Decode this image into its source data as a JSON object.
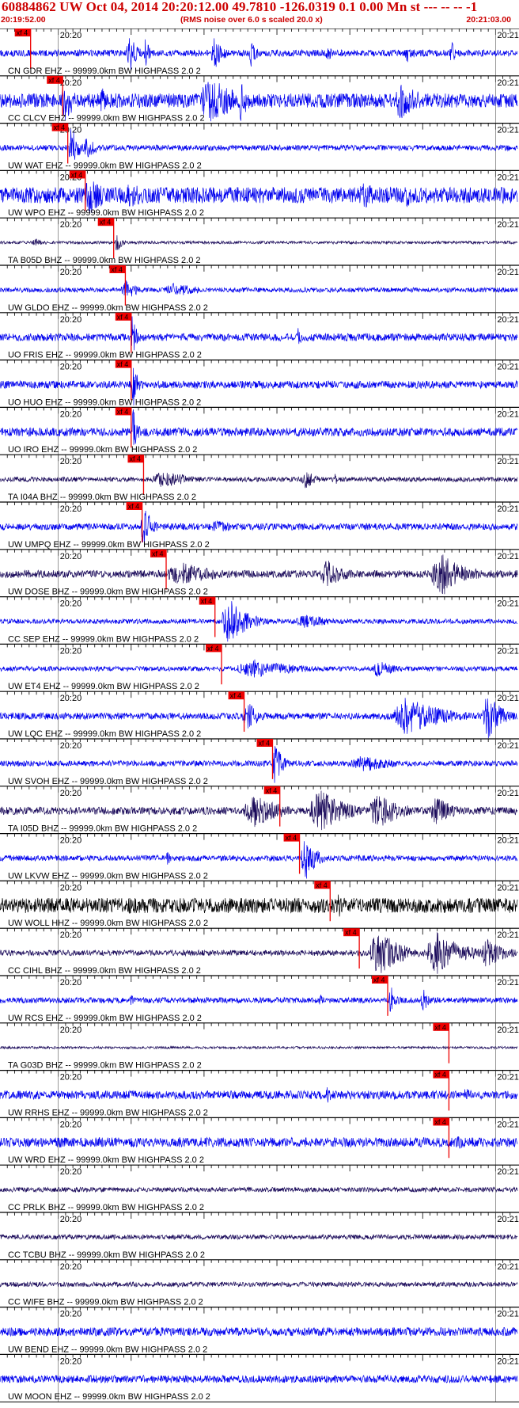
{
  "header": {
    "title": "60884862 UW Oct 04, 2014 20:20:12.00   49.7810 -126.0319  0.1 0.00 Mn st --- -- --   -1",
    "start_time": "20:19:52.00",
    "noise_note": "(RMS noise over 6.0 s scaled 20.0 x)",
    "end_time": "20:21:03.00"
  },
  "chart_data": {
    "type": "line",
    "title": "60884862 UW Oct 04, 2014 20:20:12.00   49.7810 -126.0319  0.1 0.00 Mn st --- -- --   -1",
    "x_axis": {
      "start": "20:19:52.00",
      "end": "20:21:03.00",
      "duration_s": 71,
      "tick_labels": [
        "20:20",
        "20:21"
      ],
      "tick_times_s": [
        8,
        68
      ],
      "minor_tick_interval_s": 1
    },
    "grid": true,
    "pick_label": "xf 4",
    "colors": {
      "trace_blue": "#0000ee",
      "trace_dark": "#1a0a5a",
      "trace_black": "#000000",
      "pick": "#ee0000",
      "header": "#cc0000",
      "text": "#000000"
    },
    "traces": [
      {
        "label": "CN GDR EHZ -- 99999.0km BW  HIGHPASS  2.0  2",
        "color": "blue",
        "pick_s": 4.2,
        "noise": 0.14,
        "seed": 11,
        "bursts": [
          [
            17.8,
            1.6,
            0.9
          ],
          [
            20.0,
            1.0,
            0.7
          ],
          [
            29.5,
            2.0,
            0.7
          ],
          [
            34.5,
            1.2,
            0.6
          ],
          [
            45.0,
            1.0,
            0.5
          ],
          [
            56.0,
            1.4,
            0.5
          ],
          [
            62.0,
            1.0,
            0.5
          ]
        ]
      },
      {
        "label": "CC CLCV EHZ -- 99999.0km BW  HIGHPASS  2.0  2",
        "color": "blue",
        "pick_s": 8.6,
        "noise": 0.3,
        "seed": 23,
        "bursts": [
          [
            9.0,
            2.0,
            1.0
          ],
          [
            14.0,
            1.4,
            0.6
          ],
          [
            29.0,
            6.0,
            1.0
          ],
          [
            33.0,
            2.0,
            0.9
          ],
          [
            55.0,
            5.0,
            0.8
          ]
        ]
      },
      {
        "label": "UW WAT EHZ -- 99999.0km BW  HIGHPASS  2.0  2",
        "color": "blue",
        "pick_s": 9.3,
        "noise": 0.12,
        "seed": 37,
        "bursts": [
          [
            9.8,
            1.5,
            1.0
          ],
          [
            12.0,
            2.0,
            0.5
          ]
        ]
      },
      {
        "label": "UW WPO EHZ -- 99999.0km BW  HIGHPASS  2.0  2",
        "color": "blue",
        "pick_s": 11.7,
        "noise": 0.34,
        "seed": 41,
        "bursts": [
          [
            12.5,
            4.0,
            0.8
          ],
          [
            18.0,
            6.0,
            0.5
          ],
          [
            50.0,
            4.0,
            0.6
          ],
          [
            56.0,
            2.0,
            0.5
          ]
        ]
      },
      {
        "label": "TA B05D BHZ -- 99999.0km BW  HIGHPASS  2.0  2",
        "color": "dark",
        "pick_s": 15.6,
        "noise": 0.06,
        "seed": 53,
        "bursts": [
          [
            16.0,
            1.0,
            0.5
          ],
          [
            5.0,
            3.0,
            0.15
          ]
        ]
      },
      {
        "label": "UW GLDO EHZ -- 99999.0km BW  HIGHPASS  2.0  2",
        "color": "blue",
        "pick_s": 17.2,
        "noise": 0.1,
        "seed": 61,
        "bursts": [
          [
            17.4,
            3.0,
            0.4
          ],
          [
            24.0,
            6.0,
            0.3
          ]
        ]
      },
      {
        "label": "UO FRIS EHZ -- 99999.0km BW  HIGHPASS  2.0  2",
        "color": "blue",
        "pick_s": 18.0,
        "noise": 0.16,
        "seed": 71,
        "bursts": [
          [
            18.2,
            0.9,
            1.0
          ],
          [
            41.0,
            0.8,
            0.5
          ]
        ]
      },
      {
        "label": "UO HUO EHZ -- 99999.0km BW  HIGHPASS  2.0  2",
        "color": "blue",
        "pick_s": 18.0,
        "noise": 0.16,
        "seed": 79,
        "bursts": [
          [
            18.3,
            1.0,
            1.0
          ]
        ]
      },
      {
        "label": "UO IRO EHZ -- 99999.0km BW  HIGHPASS  2.0  2",
        "color": "blue",
        "pick_s": 18.0,
        "noise": 0.18,
        "seed": 83,
        "bursts": [
          [
            18.3,
            1.0,
            1.0
          ]
        ]
      },
      {
        "label": "TA I04A BHZ -- 99999.0km BW  HIGHPASS  2.0  2",
        "color": "dark",
        "pick_s": 19.7,
        "noise": 0.1,
        "seed": 97,
        "bursts": [
          [
            22.5,
            7.0,
            0.35
          ],
          [
            42.0,
            2.5,
            0.4
          ],
          [
            46.0,
            1.0,
            0.25
          ]
        ]
      },
      {
        "label": "UW UMPQ EHZ -- 99999.0km BW  HIGHPASS  2.0  2",
        "color": "blue",
        "pick_s": 19.5,
        "noise": 0.14,
        "seed": 101,
        "bursts": [
          [
            19.8,
            1.8,
            0.9
          ],
          [
            30.0,
            6.0,
            0.25
          ]
        ]
      },
      {
        "label": "UW DOSE BHZ -- 99999.0km BW  HIGHPASS  2.0  2",
        "color": "dark",
        "pick_s": 22.8,
        "noise": 0.16,
        "seed": 107,
        "bursts": [
          [
            25.0,
            8.0,
            0.5
          ],
          [
            45.0,
            4.0,
            0.6
          ],
          [
            60.5,
            5.0,
            1.0
          ]
        ]
      },
      {
        "label": "CC SEP EHZ -- 99999.0km BW  HIGHPASS  2.0  2",
        "color": "blue",
        "pick_s": 29.5,
        "noise": 0.1,
        "seed": 113,
        "bursts": [
          [
            31.5,
            4.0,
            1.0
          ],
          [
            42.0,
            6.0,
            0.3
          ]
        ]
      },
      {
        "label": "UW ET4 EHZ -- 99999.0km BW  HIGHPASS  2.0  2",
        "color": "blue",
        "pick_s": 30.4,
        "noise": 0.1,
        "seed": 127,
        "bursts": [
          [
            35.0,
            10.0,
            0.4
          ],
          [
            52.0,
            4.0,
            0.35
          ]
        ]
      },
      {
        "label": "UW LQC EHZ -- 99999.0km BW  HIGHPASS  2.0  2",
        "color": "blue",
        "pick_s": 33.5,
        "noise": 0.14,
        "seed": 131,
        "bursts": [
          [
            34.0,
            3.0,
            0.6
          ],
          [
            56.0,
            8.0,
            0.8
          ],
          [
            67.0,
            3.0,
            1.0
          ]
        ]
      },
      {
        "label": "UW SVOH EHZ -- 99999.0km BW  HIGHPASS  2.0  2",
        "color": "blue",
        "pick_s": 37.4,
        "noise": 0.12,
        "seed": 137,
        "bursts": [
          [
            37.8,
            1.6,
            0.9
          ],
          [
            50.0,
            8.0,
            0.35
          ]
        ]
      },
      {
        "label": "TA I05D BHZ -- 99999.0km BW  HIGHPASS  2.0  2",
        "color": "dark",
        "pick_s": 38.4,
        "noise": 0.16,
        "seed": 139,
        "bursts": [
          [
            35.0,
            6.0,
            0.7
          ],
          [
            44.0,
            6.0,
            0.9
          ],
          [
            52.0,
            5.0,
            0.8
          ],
          [
            60.0,
            4.0,
            0.6
          ]
        ]
      },
      {
        "label": "UW LKVW EHZ -- 99999.0km BW  HIGHPASS  2.0  2",
        "color": "blue",
        "pick_s": 41.1,
        "noise": 0.12,
        "seed": 149,
        "bursts": [
          [
            42.0,
            2.5,
            0.9
          ],
          [
            23.0,
            1.0,
            0.3
          ]
        ]
      },
      {
        "label": "UW WOLL HHZ -- 99999.0km BW  HIGHPASS  2.0  2",
        "color": "black",
        "pick_s": 45.3,
        "noise": 0.32,
        "seed": 151,
        "bursts": [
          [
            46.5,
            1.5,
            0.6
          ]
        ]
      },
      {
        "label": "CC CIHL BHZ -- 99999.0km BW  HIGHPASS  2.0  2",
        "color": "dark",
        "pick_s": 49.3,
        "noise": 0.12,
        "seed": 157,
        "bursts": [
          [
            52.0,
            5.0,
            1.0
          ],
          [
            60.0,
            6.0,
            0.9
          ],
          [
            67.0,
            4.0,
            0.7
          ]
        ]
      },
      {
        "label": "UW RCS EHZ -- 99999.0km BW  HIGHPASS  2.0  2",
        "color": "blue",
        "pick_s": 53.2,
        "noise": 0.12,
        "seed": 163,
        "bursts": [
          [
            53.6,
            1.2,
            0.8
          ],
          [
            58.0,
            1.0,
            0.8
          ],
          [
            44.0,
            1.0,
            0.3
          ],
          [
            18.0,
            1.0,
            0.25
          ]
        ]
      },
      {
        "label": "TA G03D BHZ -- 99999.0km BW  HIGHPASS  2.0  2",
        "color": "dark",
        "pick_s": 61.6,
        "noise": 0.05,
        "seed": 167,
        "bursts": []
      },
      {
        "label": "UW RRHS EHZ -- 99999.0km BW  HIGHPASS  2.0  2",
        "color": "blue",
        "pick_s": 61.6,
        "noise": 0.18,
        "seed": 173,
        "bursts": [
          [
            45.0,
            1.2,
            0.4
          ],
          [
            64.0,
            2.0,
            0.3
          ]
        ]
      },
      {
        "label": "UW WRD EHZ -- 99999.0km BW  HIGHPASS  2.0  2",
        "color": "blue",
        "pick_s": 61.6,
        "noise": 0.2,
        "seed": 179,
        "bursts": [
          [
            63.0,
            3.0,
            0.3
          ]
        ]
      },
      {
        "label": "CC PRLK BHZ -- 99999.0km BW  HIGHPASS  2.0  2",
        "color": "dark",
        "pick_s": null,
        "noise": 0.1,
        "seed": 181,
        "bursts": []
      },
      {
        "label": "CC TCBU BHZ -- 99999.0km BW  HIGHPASS  2.0  2",
        "color": "dark",
        "pick_s": null,
        "noise": 0.1,
        "seed": 191,
        "bursts": []
      },
      {
        "label": "CC WIFE BHZ -- 99999.0km BW  HIGHPASS  2.0  2",
        "color": "dark",
        "pick_s": null,
        "noise": 0.1,
        "seed": 193,
        "bursts": []
      },
      {
        "label": "UW BEND EHZ -- 99999.0km BW  HIGHPASS  2.0  2",
        "color": "blue",
        "pick_s": null,
        "noise": 0.18,
        "seed": 197,
        "bursts": []
      },
      {
        "label": "UW MOON EHZ -- 99999.0km BW  HIGHPASS  2.0  2",
        "color": "blue",
        "pick_s": null,
        "noise": 0.16,
        "seed": 199,
        "bursts": []
      }
    ]
  }
}
